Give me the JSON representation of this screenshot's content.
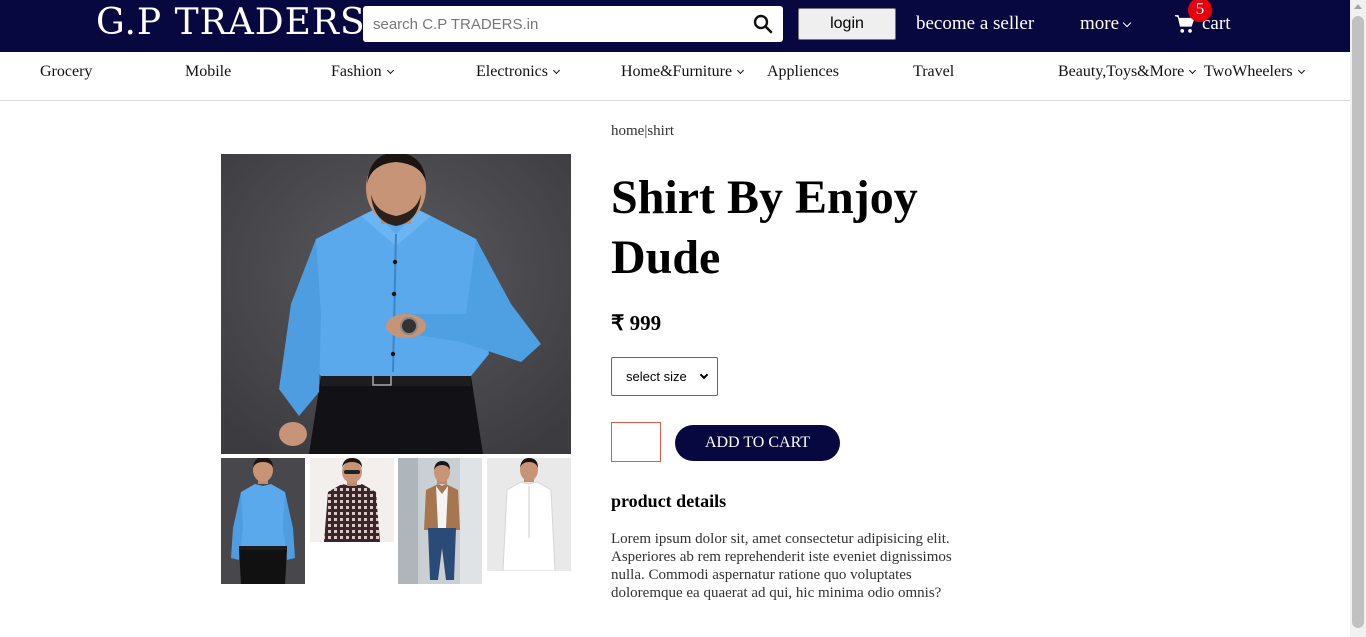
{
  "header": {
    "logo": "G.P TRADERS",
    "search_placeholder": "search C.P TRADERS.in",
    "login_label": "login",
    "seller_label": "become a seller",
    "more_label": "more",
    "cart_label": "cart",
    "cart_count": "5"
  },
  "categories": [
    {
      "label": "Grocery"
    },
    {
      "label": "Mobile"
    },
    {
      "label": "Fashion"
    },
    {
      "label": "Electronics"
    },
    {
      "label": "Home&Furniture"
    },
    {
      "label": "Appliences"
    },
    {
      "label": "Travel"
    },
    {
      "label": "Beauty,Toys&More"
    },
    {
      "label": "TwoWheelers"
    }
  ],
  "product": {
    "breadcrumb": "home|shirt",
    "title": "Shirt By Enjoy Dude",
    "price": "₹ 999",
    "size_select": "select size",
    "add_to_cart": "ADD TO CART",
    "details_heading": "product details",
    "details_text": "Lorem ipsum dolor sit, amet consectetur adipisicing elit. Asperiores ab rem reprehenderit iste eveniet dignissimos nulla. Commodi aspernatur ratione quo voluptates doloremque ea quaerat ad qui, hic minima odio omnis?"
  },
  "colors": {
    "brand_navy": "#080840",
    "badge_red": "#e8000b",
    "shirt_blue": "#5aa9ec"
  }
}
